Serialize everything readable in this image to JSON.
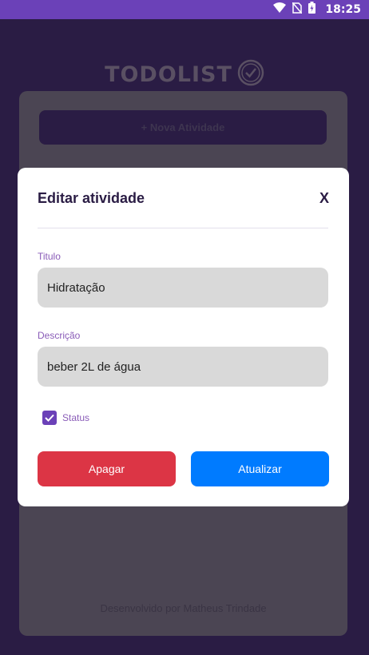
{
  "status_bar": {
    "time": "18:25",
    "icons": [
      "wifi-icon",
      "no-sim-icon",
      "battery-icon"
    ]
  },
  "app": {
    "logo_text": "TODOLIST",
    "new_activity_label": "+ Nova Atividade",
    "footer": "Desenvolvido por Matheus Trindade"
  },
  "modal": {
    "title": "Editar atividade",
    "close_label": "X",
    "title_field": {
      "label": "Titulo",
      "value": "Hidratação"
    },
    "description_field": {
      "label": "Descrição",
      "value": "beber 2L de água"
    },
    "status": {
      "label": "Status",
      "checked": true
    },
    "delete_label": "Apagar",
    "update_label": "Atualizar"
  },
  "colors": {
    "accent": "#6b41b8",
    "delete": "#dc3545",
    "update": "#007bff",
    "background": "#2a1c44"
  }
}
